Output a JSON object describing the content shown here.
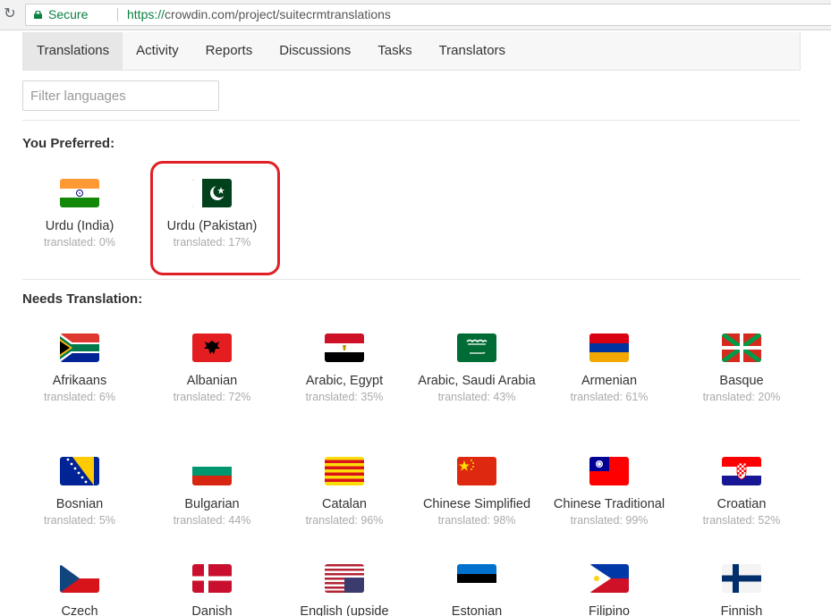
{
  "browser": {
    "secure_label": "Secure",
    "url_scheme": "https://",
    "url_rest": "crowdin.com/project/suitecrmtranslations"
  },
  "tabs": [
    {
      "label": "Translations",
      "active": true
    },
    {
      "label": "Activity"
    },
    {
      "label": "Reports"
    },
    {
      "label": "Discussions"
    },
    {
      "label": "Tasks"
    },
    {
      "label": "Translators"
    }
  ],
  "filter": {
    "placeholder": "Filter languages"
  },
  "preferred": {
    "heading": "You Preferred:",
    "languages": [
      {
        "name": "Urdu (India)",
        "progress": "translated: 0%",
        "flag": "india-flag"
      },
      {
        "name": "Urdu (Pakistan)",
        "progress": "translated: 17%",
        "flag": "pakistan-flag",
        "highlighted": true
      }
    ]
  },
  "needs_translation": {
    "heading": "Needs Translation:",
    "languages": [
      {
        "name": "Afrikaans",
        "progress": "translated: 6%",
        "flag": "south-africa-flag"
      },
      {
        "name": "Albanian",
        "progress": "translated: 72%",
        "flag": "albania-flag"
      },
      {
        "name": "Arabic, Egypt",
        "progress": "translated: 35%",
        "flag": "egypt-flag"
      },
      {
        "name": "Arabic, Saudi Arabia",
        "progress": "translated: 43%",
        "flag": "saudi-arabia-flag"
      },
      {
        "name": "Armenian",
        "progress": "translated: 61%",
        "flag": "armenia-flag"
      },
      {
        "name": "Basque",
        "progress": "translated: 20%",
        "flag": "basque-flag"
      },
      {
        "name": "Bosnian",
        "progress": "translated: 5%",
        "flag": "bosnia-flag"
      },
      {
        "name": "Bulgarian",
        "progress": "translated: 44%",
        "flag": "bulgaria-flag"
      },
      {
        "name": "Catalan",
        "progress": "translated: 96%",
        "flag": "catalonia-flag"
      },
      {
        "name": "Chinese Simplified",
        "progress": "translated: 98%",
        "flag": "china-flag"
      },
      {
        "name": "Chinese Traditional",
        "progress": "translated: 99%",
        "flag": "taiwan-flag"
      },
      {
        "name": "Croatian",
        "progress": "translated: 52%",
        "flag": "croatia-flag"
      },
      {
        "name": "Czech",
        "progress": "",
        "flag": "czech-flag"
      },
      {
        "name": "Danish",
        "progress": "",
        "flag": "denmark-flag"
      },
      {
        "name": "English (upside",
        "progress": "",
        "flag": "usa-flag"
      },
      {
        "name": "Estonian",
        "progress": "",
        "flag": "estonia-flag"
      },
      {
        "name": "Filipino",
        "progress": "",
        "flag": "philippines-flag"
      },
      {
        "name": "Finnish",
        "progress": "",
        "flag": "finland-flag"
      }
    ]
  }
}
